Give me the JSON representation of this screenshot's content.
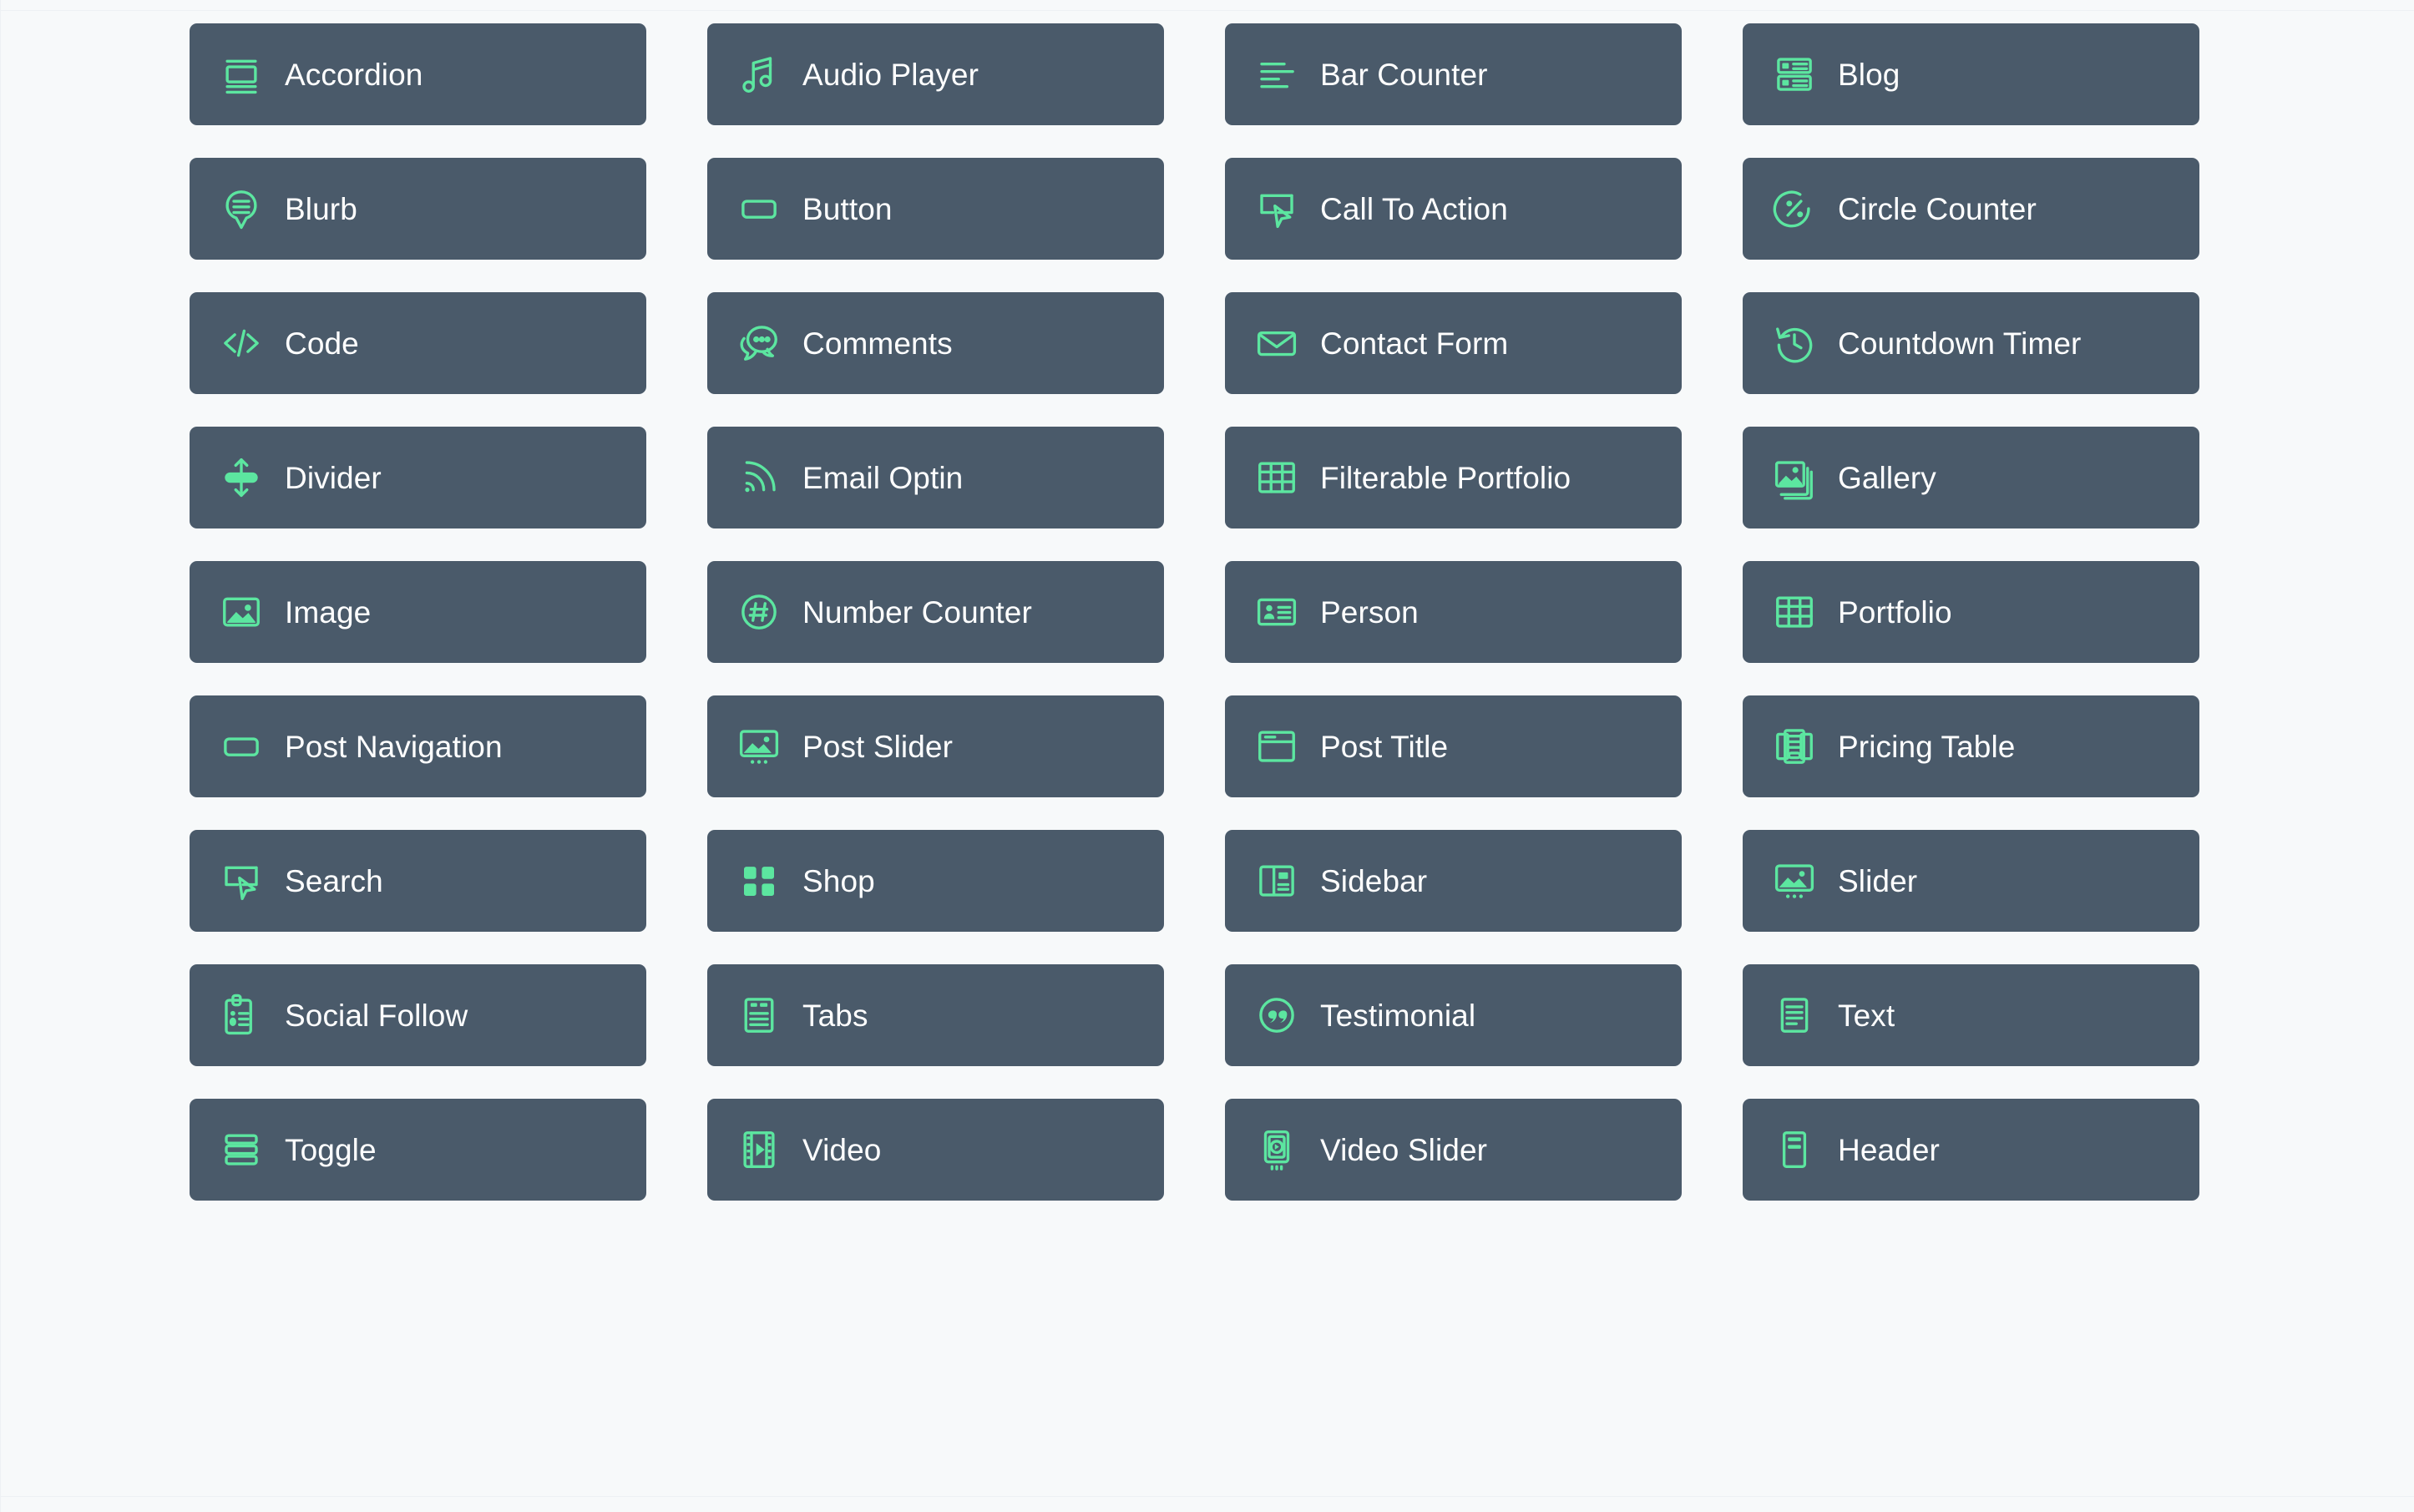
{
  "theme": {
    "page_background": "#f7f9fa",
    "card_background": "#4a5a6a",
    "icon_accent": "#5ce6a0",
    "label_color": "#ffffff"
  },
  "grid": {
    "columns": 4,
    "rows": 9,
    "total_modules": 36
  },
  "modules": [
    {
      "label": "Accordion",
      "icon": "accordion-icon"
    },
    {
      "label": "Audio Player",
      "icon": "music-note-icon"
    },
    {
      "label": "Bar Counter",
      "icon": "horizontal-bars-icon"
    },
    {
      "label": "Blog",
      "icon": "blog-list-icon"
    },
    {
      "label": "Blurb",
      "icon": "speech-pin-icon"
    },
    {
      "label": "Button",
      "icon": "rounded-rectangle-icon"
    },
    {
      "label": "Call To Action",
      "icon": "cursor-click-box-icon"
    },
    {
      "label": "Circle Counter",
      "icon": "percent-circle-icon"
    },
    {
      "label": "Code",
      "icon": "code-brackets-icon"
    },
    {
      "label": "Comments",
      "icon": "chat-bubbles-icon"
    },
    {
      "label": "Contact Form",
      "icon": "envelope-icon"
    },
    {
      "label": "Countdown Timer",
      "icon": "clock-rewind-icon"
    },
    {
      "label": "Divider",
      "icon": "vertical-arrows-bar-icon"
    },
    {
      "label": "Email Optin",
      "icon": "rss-signal-icon"
    },
    {
      "label": "Filterable Portfolio",
      "icon": "grid-table-icon"
    },
    {
      "label": "Gallery",
      "icon": "stacked-images-icon"
    },
    {
      "label": "Image",
      "icon": "image-icon"
    },
    {
      "label": "Number Counter",
      "icon": "hash-circle-icon"
    },
    {
      "label": "Person",
      "icon": "id-card-icon"
    },
    {
      "label": "Portfolio",
      "icon": "grid-table-icon"
    },
    {
      "label": "Post Navigation",
      "icon": "rounded-rectangle-icon"
    },
    {
      "label": "Post Slider",
      "icon": "image-slider-icon"
    },
    {
      "label": "Post Title",
      "icon": "window-header-icon"
    },
    {
      "label": "Pricing Table",
      "icon": "pricing-sheets-icon"
    },
    {
      "label": "Search",
      "icon": "cursor-click-box-icon"
    },
    {
      "label": "Shop",
      "icon": "four-squares-icon"
    },
    {
      "label": "Sidebar",
      "icon": "sidebar-layout-icon"
    },
    {
      "label": "Slider",
      "icon": "image-slider-icon"
    },
    {
      "label": "Social Follow",
      "icon": "clipboard-people-icon"
    },
    {
      "label": "Tabs",
      "icon": "tabbed-document-icon"
    },
    {
      "label": "Testimonial",
      "icon": "quote-circle-icon"
    },
    {
      "label": "Text",
      "icon": "text-lines-document-icon"
    },
    {
      "label": "Toggle",
      "icon": "stacked-bars-icon"
    },
    {
      "label": "Video",
      "icon": "film-play-icon"
    },
    {
      "label": "Video Slider",
      "icon": "video-slider-icon"
    },
    {
      "label": "Header",
      "icon": "header-block-icon"
    }
  ]
}
